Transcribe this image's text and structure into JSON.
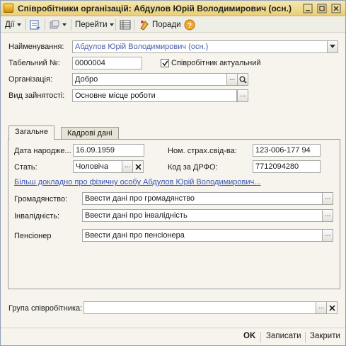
{
  "window": {
    "title": "Співробітники організацій: Абдулов Юрій Володимирович (осн.)"
  },
  "toolbar": {
    "actions_label": "Дії",
    "goto_label": "Перейти",
    "tips_label": "Поради"
  },
  "form": {
    "name_label": "Найменування:",
    "name_value": "Абдулов Юрій Володимирович (осн.)",
    "tabnum_label": "Табельний №:",
    "tabnum_value": "0000004",
    "active_label": "Співробітник актуальний",
    "active_checked": true,
    "org_label": "Організація:",
    "org_value": "Добро",
    "employment_label": "Вид зайнятості:",
    "employment_value": "Основне місце роботи"
  },
  "tabs": [
    {
      "label": "Загальне",
      "active": true
    },
    {
      "label": "Кадрові дані",
      "active": false
    }
  ],
  "general": {
    "birth_label": "Дата народже...",
    "birth_value": "16.09.1959",
    "insurance_label": "Ном. страх.свід-ва:",
    "insurance_value": "123-006-177 94",
    "sex_label": "Стать:",
    "sex_value": "Чоловіча",
    "tax_label": "Код за ДРФО:",
    "tax_value": "7712094280",
    "details_link": "Більш докладно про фізичну особу Абдулов Юрій Володимирович...",
    "citizenship_label": "Громадянство:",
    "citizenship_value": "Ввести дані про громадянство",
    "disability_label": "Інвалідність:",
    "disability_value": "Ввести дані про інвалідність",
    "pensioner_label": "Пенсіонер",
    "pensioner_value": "Ввести дані про пенсіонера"
  },
  "group": {
    "label": "Група співробітника:",
    "value": ""
  },
  "buttons": {
    "ok": "OK",
    "save": "Записати",
    "close": "Закрити"
  },
  "colors": {
    "titlebar": "#e9cf78",
    "link": "#3a56b8",
    "background": "#f6f4ec"
  }
}
